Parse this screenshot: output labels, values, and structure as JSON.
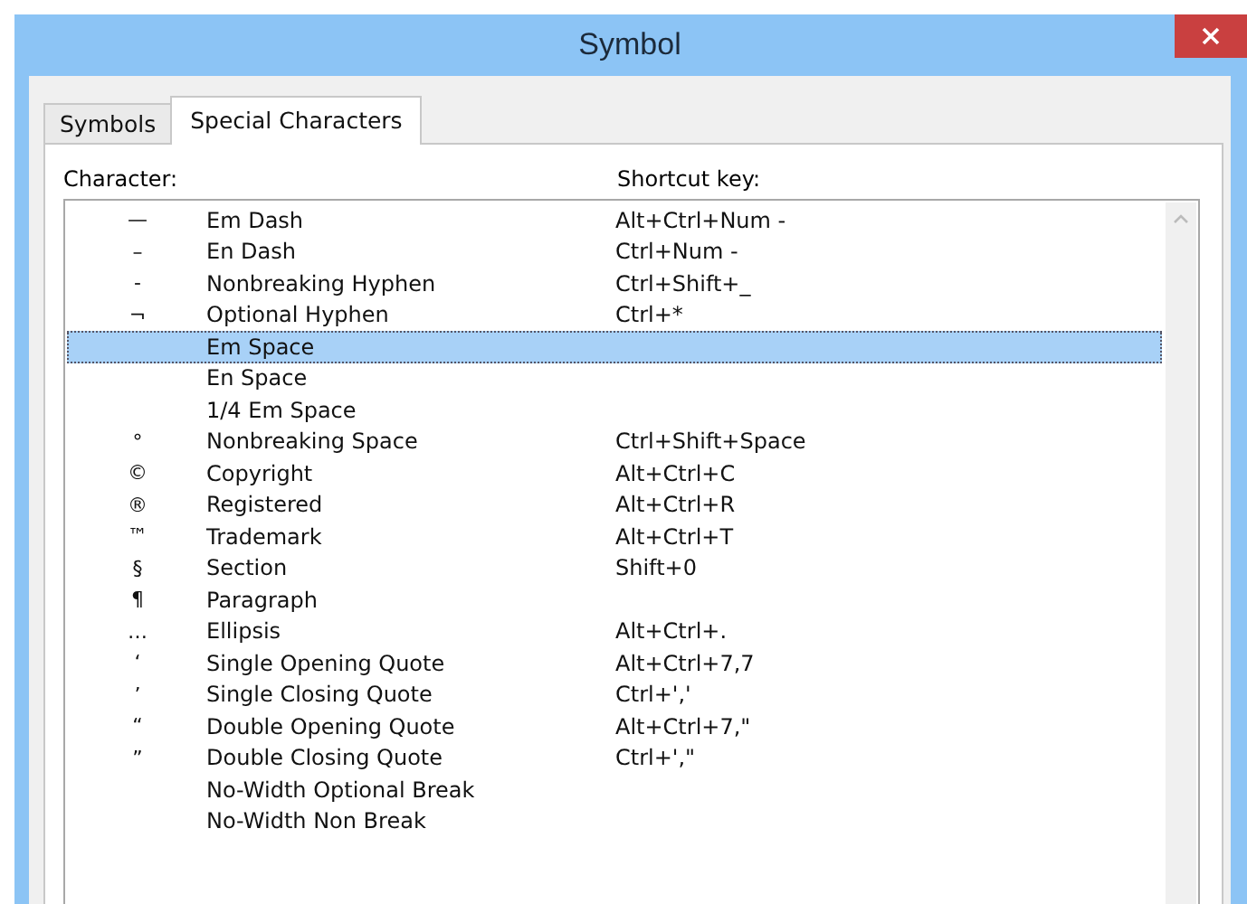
{
  "window": {
    "title": "Symbol"
  },
  "tabs": [
    {
      "label": "Symbols",
      "selected": false
    },
    {
      "label": "Special Characters",
      "selected": true
    }
  ],
  "list": {
    "column_labels": [
      "Character:",
      "Shortcut key:"
    ],
    "rows": [
      {
        "symbol": "—",
        "name": "Em Dash",
        "shortcut": "Alt+Ctrl+Num -",
        "selected": false
      },
      {
        "symbol": "–",
        "name": "En Dash",
        "shortcut": "Ctrl+Num -",
        "selected": false
      },
      {
        "symbol": "-",
        "name": "Nonbreaking Hyphen",
        "shortcut": "Ctrl+Shift+_",
        "selected": false
      },
      {
        "symbol": "¬",
        "name": "Optional Hyphen",
        "shortcut": "Ctrl+*",
        "selected": false
      },
      {
        "name": "Em Space",
        "selected": true
      },
      {
        "name": "En Space",
        "selected": false
      },
      {
        "name": "1/4 Em Space",
        "selected": false
      },
      {
        "symbol": "°",
        "name": "Nonbreaking Space",
        "shortcut": "Ctrl+Shift+Space",
        "selected": false
      },
      {
        "symbol": "©",
        "name": "Copyright",
        "shortcut": "Alt+Ctrl+C",
        "selected": false
      },
      {
        "symbol": "®",
        "name": "Registered",
        "shortcut": "Alt+Ctrl+R",
        "selected": false
      },
      {
        "symbol": "™",
        "name": "Trademark",
        "shortcut": "Alt+Ctrl+T",
        "selected": false
      },
      {
        "symbol": "§",
        "name": "Section",
        "shortcut": "Shift+0",
        "selected": false
      },
      {
        "symbol": "¶",
        "name": "Paragraph",
        "selected": false
      },
      {
        "symbol": "…",
        "name": "Ellipsis",
        "shortcut": "Alt+Ctrl+.",
        "selected": false
      },
      {
        "symbol": "‘",
        "name": "Single Opening Quote",
        "shortcut": "Alt+Ctrl+7,7",
        "selected": false
      },
      {
        "symbol": "’",
        "name": "Single Closing Quote",
        "shortcut": "Ctrl+','",
        "selected": false
      },
      {
        "symbol": "“",
        "name": "Double Opening Quote",
        "shortcut": "Alt+Ctrl+7,\"",
        "selected": false
      },
      {
        "symbol": "”",
        "name": "Double Closing Quote",
        "shortcut": "Ctrl+',\"",
        "selected": false
      },
      {
        "name": "No-Width Optional Break",
        "selected": false
      },
      {
        "name": "No-Width Non Break",
        "selected": false
      }
    ]
  }
}
